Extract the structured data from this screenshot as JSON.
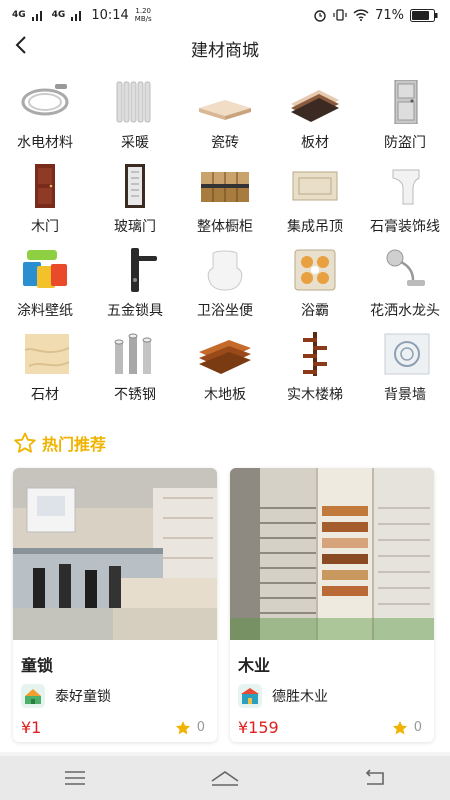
{
  "status": {
    "network": "4G",
    "network2": "4G",
    "time": "10:14",
    "speed_value": "1.20",
    "speed_unit": "MB/s",
    "battery": "71%"
  },
  "header": {
    "title": "建材商城"
  },
  "categories": [
    {
      "label": "水电材料",
      "icon": "hose-icon"
    },
    {
      "label": "采暖",
      "icon": "radiator-icon"
    },
    {
      "label": "瓷砖",
      "icon": "tile-icon"
    },
    {
      "label": "板材",
      "icon": "board-icon"
    },
    {
      "label": "防盗门",
      "icon": "security-door-icon"
    },
    {
      "label": "木门",
      "icon": "wooden-door-icon"
    },
    {
      "label": "玻璃门",
      "icon": "glass-door-icon"
    },
    {
      "label": "整体橱柜",
      "icon": "cabinet-icon"
    },
    {
      "label": "集成吊顶",
      "icon": "ceiling-icon"
    },
    {
      "label": "石膏装饰线",
      "icon": "plaster-line-icon"
    },
    {
      "label": "涂料壁纸",
      "icon": "paint-icon"
    },
    {
      "label": "五金锁具",
      "icon": "door-handle-icon"
    },
    {
      "label": "卫浴坐便",
      "icon": "toilet-icon"
    },
    {
      "label": "浴霸",
      "icon": "bath-heater-icon"
    },
    {
      "label": "花洒水龙头",
      "icon": "faucet-icon"
    },
    {
      "label": "石材",
      "icon": "stone-icon"
    },
    {
      "label": "不锈钢",
      "icon": "steel-pipe-icon"
    },
    {
      "label": "木地板",
      "icon": "wood-floor-icon"
    },
    {
      "label": "实木楼梯",
      "icon": "stairs-icon"
    },
    {
      "label": "背景墙",
      "icon": "wall-icon"
    }
  ],
  "hot": {
    "title": "热门推荐"
  },
  "products": [
    {
      "name": "童锁",
      "shop": "泰好童锁",
      "price": "¥1",
      "rating": "0"
    },
    {
      "name": "木业",
      "shop": "德胜木业",
      "price": "¥159",
      "rating": "0"
    }
  ],
  "colors": {
    "accent": "#f0b400",
    "price": "#e02020"
  }
}
